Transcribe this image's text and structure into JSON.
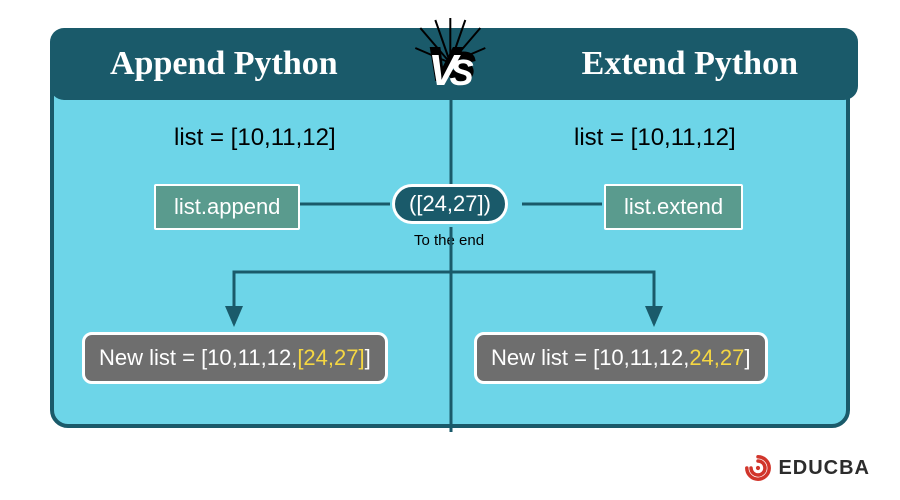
{
  "header": {
    "left_title": "Append Python",
    "right_title": "Extend Python",
    "vs_label": "VS"
  },
  "code": {
    "left_list": "list = [10,11,12]",
    "right_list": "list = [10,11,12]",
    "left_method": "list.append",
    "right_method": "list.extend",
    "argument": "([24,27])",
    "to_end_label": "To the end"
  },
  "results": {
    "left_prefix": "New list = [10,11,12,",
    "left_highlight": "[24,27]",
    "left_suffix": "]",
    "right_prefix": "New list = [10,11,12,",
    "right_highlight": "24,27",
    "right_suffix": "]"
  },
  "brand": {
    "name": "EDUCBA"
  },
  "colors": {
    "frame": "#1a5a6a",
    "panel": "#6dd5e8",
    "method_box": "#5a9b8e",
    "result_box": "#6e6e6e",
    "highlight": "#f5d742"
  }
}
